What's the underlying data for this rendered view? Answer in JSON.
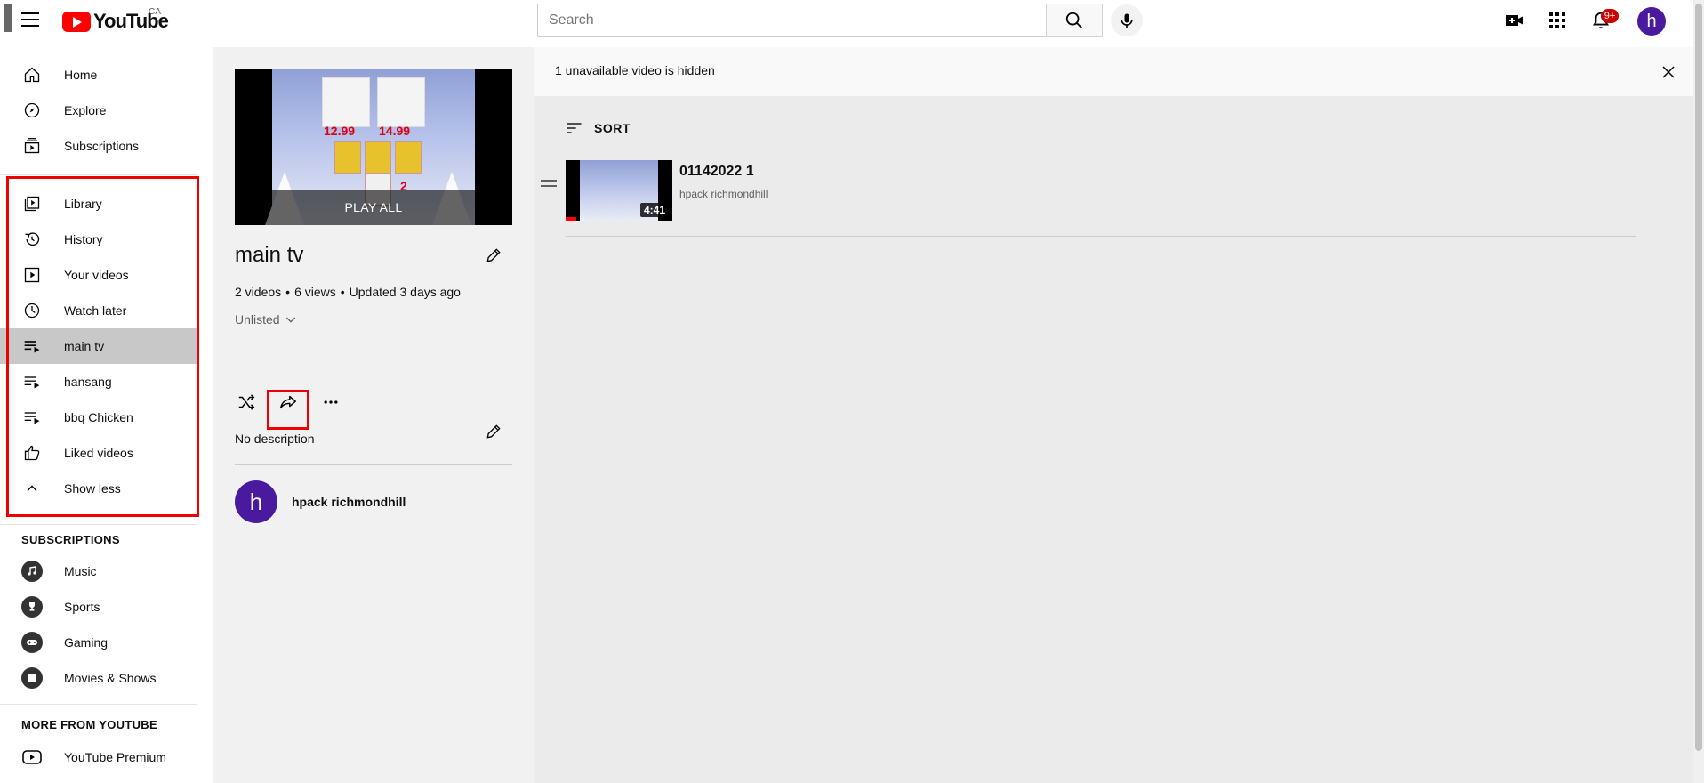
{
  "app": {
    "logo_text": "YouTube",
    "country": "CA"
  },
  "search": {
    "placeholder": "Search"
  },
  "notifications": {
    "badge": "9+"
  },
  "account": {
    "initial": "h"
  },
  "sidebar": {
    "main": [
      {
        "label": "Home",
        "icon": "home-icon"
      },
      {
        "label": "Explore",
        "icon": "compass-icon"
      },
      {
        "label": "Subscriptions",
        "icon": "subscriptions-icon"
      }
    ],
    "library": [
      {
        "label": "Library",
        "icon": "library-icon"
      },
      {
        "label": "History",
        "icon": "history-icon"
      },
      {
        "label": "Your videos",
        "icon": "your-videos-icon"
      },
      {
        "label": "Watch later",
        "icon": "clock-icon"
      },
      {
        "label": "main tv",
        "icon": "playlist-icon",
        "active": true
      },
      {
        "label": "hansang",
        "icon": "playlist-icon"
      },
      {
        "label": "bbq Chicken",
        "icon": "playlist-icon"
      },
      {
        "label": "Liked videos",
        "icon": "thumbs-up-icon"
      },
      {
        "label": "Show less",
        "icon": "chevron-up-icon"
      }
    ],
    "subscriptions_heading": "SUBSCRIPTIONS",
    "subscriptions": [
      {
        "label": "Music",
        "icon": "music-icon"
      },
      {
        "label": "Sports",
        "icon": "trophy-icon"
      },
      {
        "label": "Gaming",
        "icon": "gamepad-icon"
      },
      {
        "label": "Movies & Shows",
        "icon": "film-icon"
      }
    ],
    "more_heading": "MORE FROM YOUTUBE",
    "more": [
      {
        "label": "YouTube Premium",
        "icon": "youtube-premium-icon"
      }
    ]
  },
  "playlist": {
    "play_all": "PLAY ALL",
    "title": "main tv",
    "stats": [
      "2 videos",
      "•",
      "6 views",
      "•",
      "Updated 3 days ago"
    ],
    "privacy": "Unlisted",
    "description": "No description",
    "owner": {
      "initial": "h",
      "name": "hpack richmondhill"
    },
    "thumb_prices": [
      "12.99",
      "14.99",
      "2"
    ]
  },
  "notice": {
    "text": "1 unavailable video is hidden"
  },
  "sort": {
    "label": "SORT"
  },
  "videos": [
    {
      "title": "01142022 1",
      "channel": "hpack richmondhill",
      "duration": "4:41"
    }
  ],
  "colors": {
    "brand_red": "#ff0000",
    "avatar": "#4a1a9e",
    "highlight_box": "#ee0000"
  }
}
